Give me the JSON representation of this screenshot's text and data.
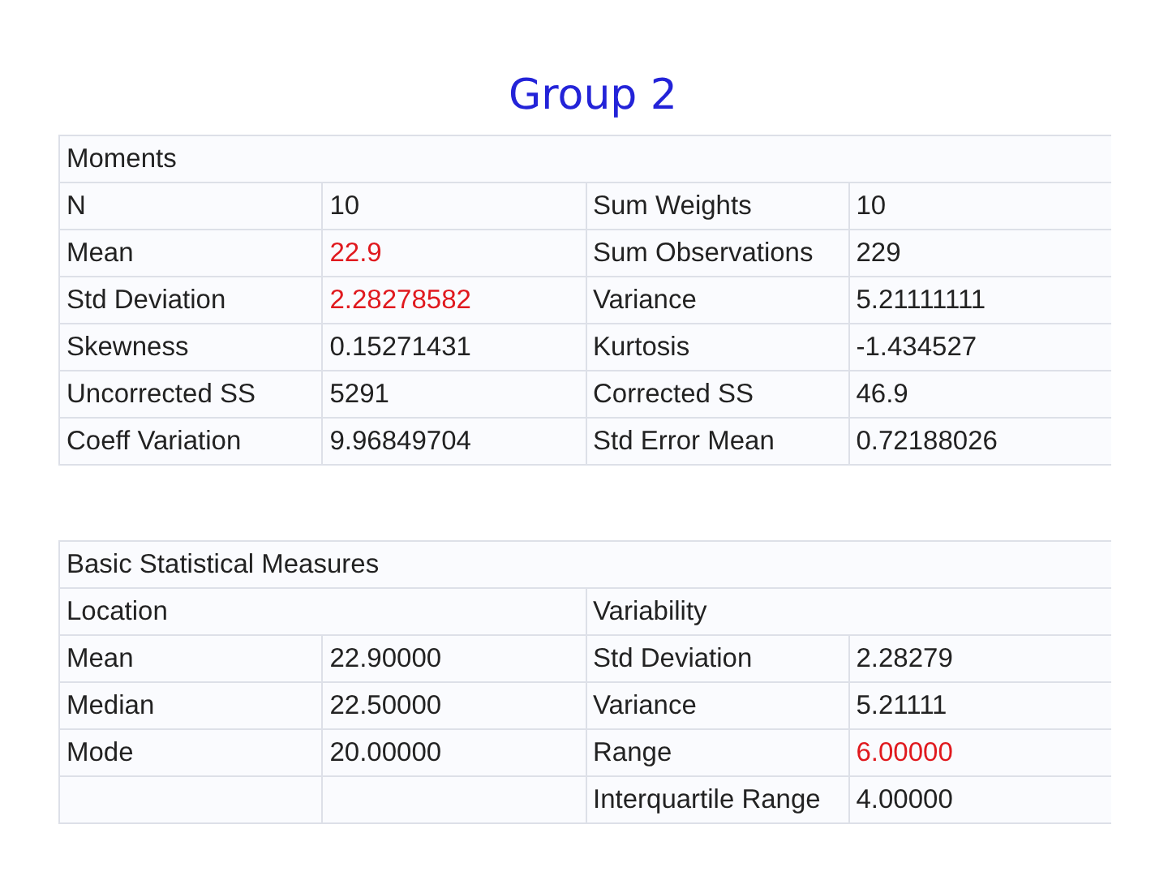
{
  "title": "Group 2",
  "tables": [
    {
      "caption": "Moments",
      "rows": [
        {
          "left": [
            {
              "text": "N",
              "highlighted": false
            },
            {
              "text": "10",
              "highlighted": false
            }
          ],
          "right": [
            {
              "text": "Sum Weights",
              "highlighted": false
            },
            {
              "text": "10",
              "highlighted": false
            }
          ]
        },
        {
          "left": [
            {
              "text": "Mean",
              "highlighted": false
            },
            {
              "text": "22.9",
              "highlighted": true
            }
          ],
          "right": [
            {
              "text": "Sum Observations",
              "highlighted": false
            },
            {
              "text": "229",
              "highlighted": false
            }
          ]
        },
        {
          "left": [
            {
              "text": "Std Deviation",
              "highlighted": false
            },
            {
              "text": "2.28278582",
              "highlighted": true
            }
          ],
          "right": [
            {
              "text": "Variance",
              "highlighted": false
            },
            {
              "text": "5.21111111",
              "highlighted": false
            }
          ]
        },
        {
          "left": [
            {
              "text": "Skewness",
              "highlighted": false
            },
            {
              "text": "0.15271431",
              "highlighted": false
            }
          ],
          "right": [
            {
              "text": "Kurtosis",
              "highlighted": false
            },
            {
              "text": "-1.434527",
              "highlighted": false
            }
          ]
        },
        {
          "left": [
            {
              "text": "Uncorrected SS",
              "highlighted": false
            },
            {
              "text": "5291",
              "highlighted": false
            }
          ],
          "right": [
            {
              "text": "Corrected SS",
              "highlighted": false
            },
            {
              "text": "46.9",
              "highlighted": false
            }
          ]
        },
        {
          "left": [
            {
              "text": "Coeff Variation",
              "highlighted": false
            },
            {
              "text": "9.96849704",
              "highlighted": false
            }
          ],
          "right": [
            {
              "text": "Std Error Mean",
              "highlighted": false
            },
            {
              "text": "0.72188026",
              "highlighted": false
            }
          ]
        }
      ]
    },
    {
      "caption": "Basic Statistical Measures",
      "groups": [
        "Location",
        "Variability"
      ],
      "rows": [
        {
          "left": [
            {
              "text": "Mean",
              "highlighted": false
            },
            {
              "text": "22.90000",
              "highlighted": false
            }
          ],
          "right": [
            {
              "text": "Std Deviation",
              "highlighted": false
            },
            {
              "text": "2.28279",
              "highlighted": false
            }
          ]
        },
        {
          "left": [
            {
              "text": "Median",
              "highlighted": false
            },
            {
              "text": "22.50000",
              "highlighted": false
            }
          ],
          "right": [
            {
              "text": "Variance",
              "highlighted": false
            },
            {
              "text": "5.21111",
              "highlighted": false
            }
          ]
        },
        {
          "left": [
            {
              "text": "Mode",
              "highlighted": false
            },
            {
              "text": "20.00000",
              "highlighted": false
            }
          ],
          "right": [
            {
              "text": "Range",
              "highlighted": false
            },
            {
              "text": "6.00000",
              "highlighted": true
            }
          ]
        },
        {
          "right": [
            {
              "text": "Interquartile Range",
              "highlighted": false
            },
            {
              "text": "4.00000",
              "highlighted": false
            }
          ]
        }
      ]
    }
  ]
}
